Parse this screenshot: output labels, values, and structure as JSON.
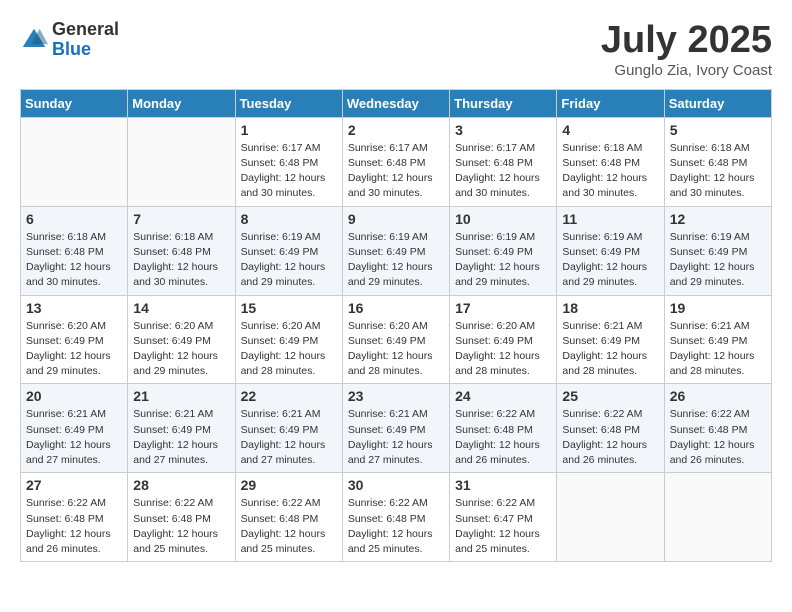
{
  "logo": {
    "general": "General",
    "blue": "Blue"
  },
  "title": {
    "month_year": "July 2025",
    "location": "Gunglo Zia, Ivory Coast"
  },
  "days_of_week": [
    "Sunday",
    "Monday",
    "Tuesday",
    "Wednesday",
    "Thursday",
    "Friday",
    "Saturday"
  ],
  "weeks": [
    [
      {
        "day": "",
        "info": ""
      },
      {
        "day": "",
        "info": ""
      },
      {
        "day": "1",
        "info": "Sunrise: 6:17 AM\nSunset: 6:48 PM\nDaylight: 12 hours and 30 minutes."
      },
      {
        "day": "2",
        "info": "Sunrise: 6:17 AM\nSunset: 6:48 PM\nDaylight: 12 hours and 30 minutes."
      },
      {
        "day": "3",
        "info": "Sunrise: 6:17 AM\nSunset: 6:48 PM\nDaylight: 12 hours and 30 minutes."
      },
      {
        "day": "4",
        "info": "Sunrise: 6:18 AM\nSunset: 6:48 PM\nDaylight: 12 hours and 30 minutes."
      },
      {
        "day": "5",
        "info": "Sunrise: 6:18 AM\nSunset: 6:48 PM\nDaylight: 12 hours and 30 minutes."
      }
    ],
    [
      {
        "day": "6",
        "info": "Sunrise: 6:18 AM\nSunset: 6:48 PM\nDaylight: 12 hours and 30 minutes."
      },
      {
        "day": "7",
        "info": "Sunrise: 6:18 AM\nSunset: 6:48 PM\nDaylight: 12 hours and 30 minutes."
      },
      {
        "day": "8",
        "info": "Sunrise: 6:19 AM\nSunset: 6:49 PM\nDaylight: 12 hours and 29 minutes."
      },
      {
        "day": "9",
        "info": "Sunrise: 6:19 AM\nSunset: 6:49 PM\nDaylight: 12 hours and 29 minutes."
      },
      {
        "day": "10",
        "info": "Sunrise: 6:19 AM\nSunset: 6:49 PM\nDaylight: 12 hours and 29 minutes."
      },
      {
        "day": "11",
        "info": "Sunrise: 6:19 AM\nSunset: 6:49 PM\nDaylight: 12 hours and 29 minutes."
      },
      {
        "day": "12",
        "info": "Sunrise: 6:19 AM\nSunset: 6:49 PM\nDaylight: 12 hours and 29 minutes."
      }
    ],
    [
      {
        "day": "13",
        "info": "Sunrise: 6:20 AM\nSunset: 6:49 PM\nDaylight: 12 hours and 29 minutes."
      },
      {
        "day": "14",
        "info": "Sunrise: 6:20 AM\nSunset: 6:49 PM\nDaylight: 12 hours and 29 minutes."
      },
      {
        "day": "15",
        "info": "Sunrise: 6:20 AM\nSunset: 6:49 PM\nDaylight: 12 hours and 28 minutes."
      },
      {
        "day": "16",
        "info": "Sunrise: 6:20 AM\nSunset: 6:49 PM\nDaylight: 12 hours and 28 minutes."
      },
      {
        "day": "17",
        "info": "Sunrise: 6:20 AM\nSunset: 6:49 PM\nDaylight: 12 hours and 28 minutes."
      },
      {
        "day": "18",
        "info": "Sunrise: 6:21 AM\nSunset: 6:49 PM\nDaylight: 12 hours and 28 minutes."
      },
      {
        "day": "19",
        "info": "Sunrise: 6:21 AM\nSunset: 6:49 PM\nDaylight: 12 hours and 28 minutes."
      }
    ],
    [
      {
        "day": "20",
        "info": "Sunrise: 6:21 AM\nSunset: 6:49 PM\nDaylight: 12 hours and 27 minutes."
      },
      {
        "day": "21",
        "info": "Sunrise: 6:21 AM\nSunset: 6:49 PM\nDaylight: 12 hours and 27 minutes."
      },
      {
        "day": "22",
        "info": "Sunrise: 6:21 AM\nSunset: 6:49 PM\nDaylight: 12 hours and 27 minutes."
      },
      {
        "day": "23",
        "info": "Sunrise: 6:21 AM\nSunset: 6:49 PM\nDaylight: 12 hours and 27 minutes."
      },
      {
        "day": "24",
        "info": "Sunrise: 6:22 AM\nSunset: 6:48 PM\nDaylight: 12 hours and 26 minutes."
      },
      {
        "day": "25",
        "info": "Sunrise: 6:22 AM\nSunset: 6:48 PM\nDaylight: 12 hours and 26 minutes."
      },
      {
        "day": "26",
        "info": "Sunrise: 6:22 AM\nSunset: 6:48 PM\nDaylight: 12 hours and 26 minutes."
      }
    ],
    [
      {
        "day": "27",
        "info": "Sunrise: 6:22 AM\nSunset: 6:48 PM\nDaylight: 12 hours and 26 minutes."
      },
      {
        "day": "28",
        "info": "Sunrise: 6:22 AM\nSunset: 6:48 PM\nDaylight: 12 hours and 25 minutes."
      },
      {
        "day": "29",
        "info": "Sunrise: 6:22 AM\nSunset: 6:48 PM\nDaylight: 12 hours and 25 minutes."
      },
      {
        "day": "30",
        "info": "Sunrise: 6:22 AM\nSunset: 6:48 PM\nDaylight: 12 hours and 25 minutes."
      },
      {
        "day": "31",
        "info": "Sunrise: 6:22 AM\nSunset: 6:47 PM\nDaylight: 12 hours and 25 minutes."
      },
      {
        "day": "",
        "info": ""
      },
      {
        "day": "",
        "info": ""
      }
    ]
  ]
}
